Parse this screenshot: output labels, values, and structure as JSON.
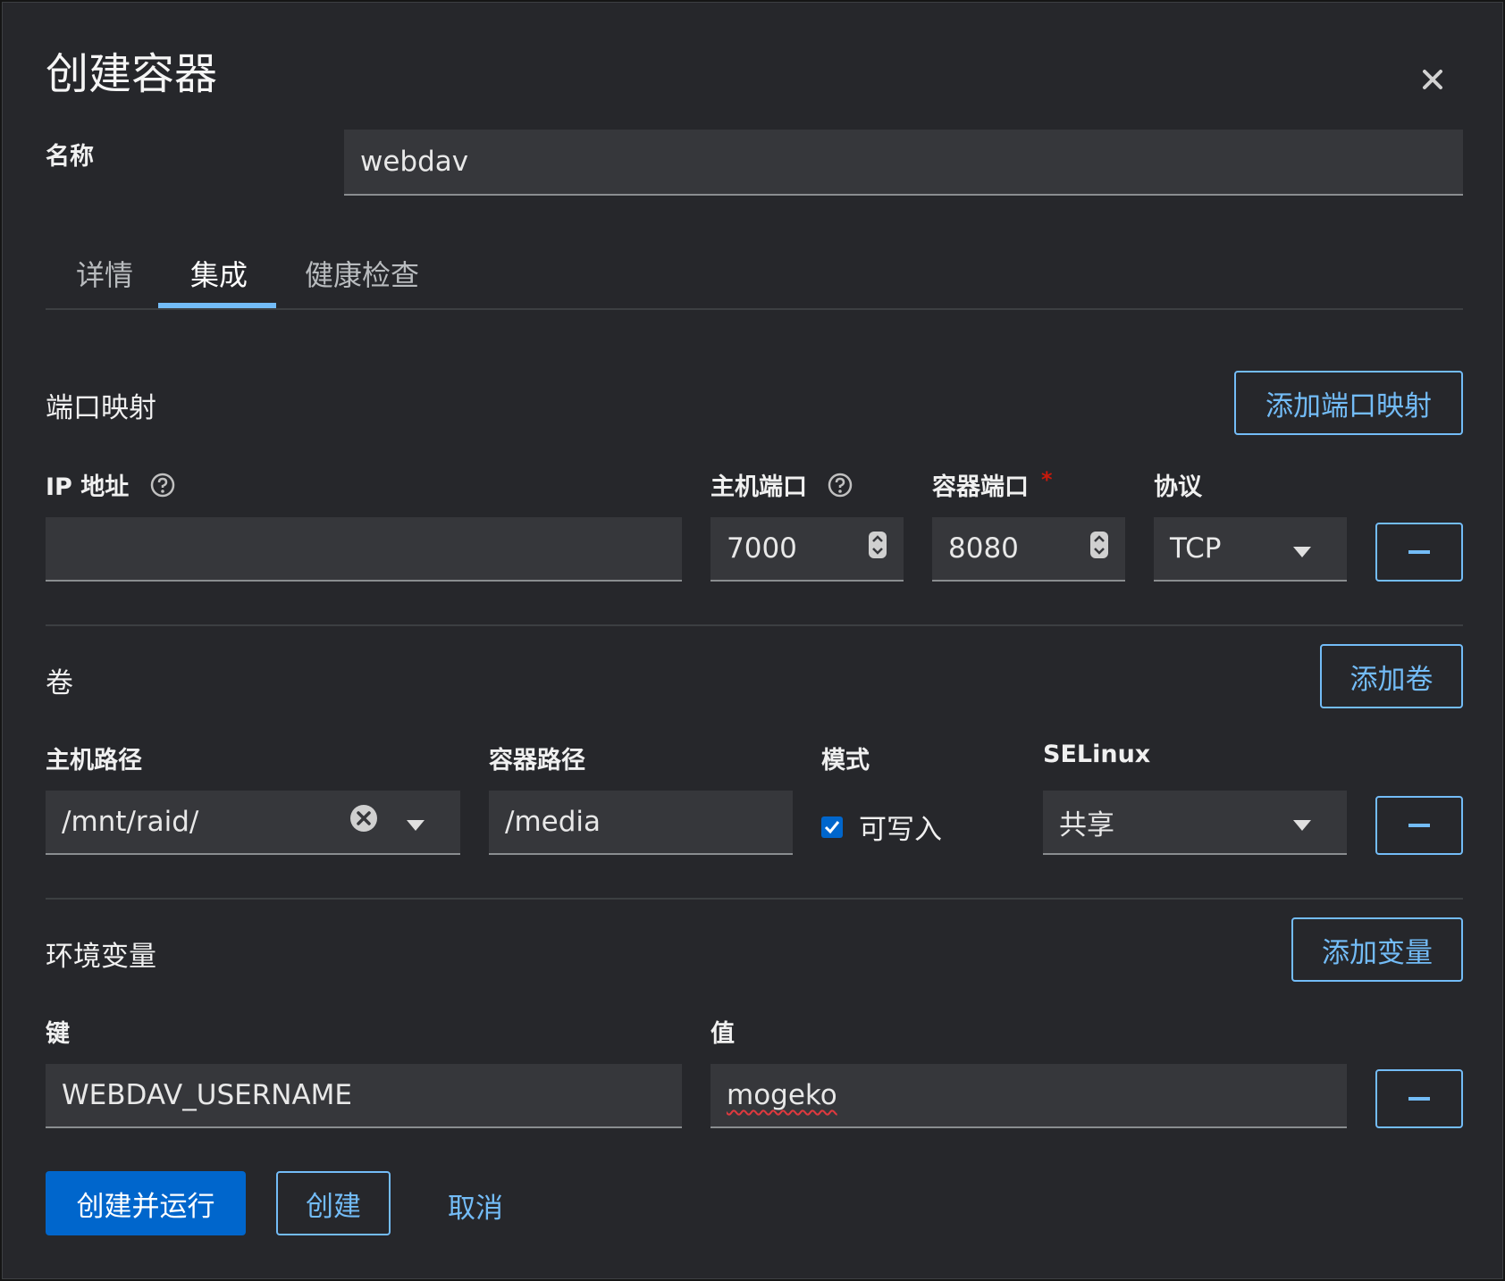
{
  "dialog": {
    "title": "创建容器"
  },
  "name": {
    "label": "名称",
    "value": "webdav"
  },
  "tabs": [
    {
      "label": "详情"
    },
    {
      "label": "集成",
      "active": true
    },
    {
      "label": "健康检查"
    }
  ],
  "ports": {
    "title": "端口映射",
    "add_label": "添加端口映射",
    "columns": {
      "ip": "IP 地址",
      "host_port": "主机端口",
      "container_port": "容器端口",
      "protocol": "协议",
      "required_mark": "*"
    },
    "row": {
      "ip": "",
      "host_port": "7000",
      "container_port": "8080",
      "protocol": "TCP"
    }
  },
  "volumes": {
    "title": "卷",
    "add_label": "添加卷",
    "columns": {
      "host_path": "主机路径",
      "container_path": "容器路径",
      "mode": "模式",
      "selinux": "SELinux"
    },
    "row": {
      "host_path": "/mnt/raid/",
      "container_path": "/media",
      "mode_label": "可写入",
      "mode_checked": true,
      "selinux": "共享"
    }
  },
  "env": {
    "title": "环境变量",
    "add_label": "添加变量",
    "columns": {
      "key": "键",
      "value": "值"
    },
    "row": {
      "key": "WEBDAV_USERNAME",
      "value": "mogeko"
    }
  },
  "footer": {
    "create_run": "创建并运行",
    "create": "创建",
    "cancel": "取消"
  },
  "colors": {
    "accent": "#73bcf7",
    "primary": "#0066cc",
    "background": "#26272b",
    "field": "#36373b",
    "required": "#c9190b"
  }
}
